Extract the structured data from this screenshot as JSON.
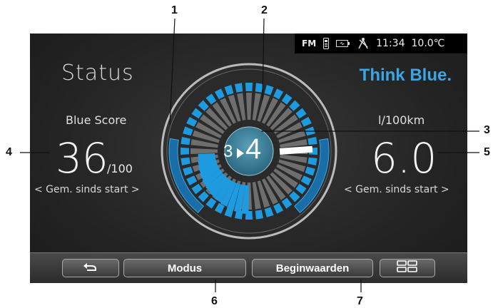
{
  "callouts": [
    "1",
    "2",
    "3",
    "4",
    "5",
    "6",
    "7"
  ],
  "statusbar": {
    "fm": "FM",
    "time": "11:34",
    "temperature": "10.0℃",
    "icons": [
      "phone-icon",
      "battery-icon",
      "satellite-icon"
    ]
  },
  "title": "Status",
  "brand": "Think Blue.",
  "left_metric": {
    "label": "Blue Score",
    "value": "36",
    "suffix": "/100",
    "sublink": "< Gem. sinds start >"
  },
  "right_metric": {
    "label": "l/100km",
    "value": "6.0",
    "sublink": "< Gem. sinds start >"
  },
  "gauge": {
    "gear_from": "3",
    "gear_to": "4",
    "colors": {
      "active": "#1e9be0",
      "inactive": "#6e6e6e",
      "side": "#1a6ea8"
    }
  },
  "toolbar": {
    "back_icon": "back-arrow-icon",
    "modus_label": "Modus",
    "beginwaarden_label": "Beginwaarden",
    "menu_icon": "grid-icon"
  }
}
